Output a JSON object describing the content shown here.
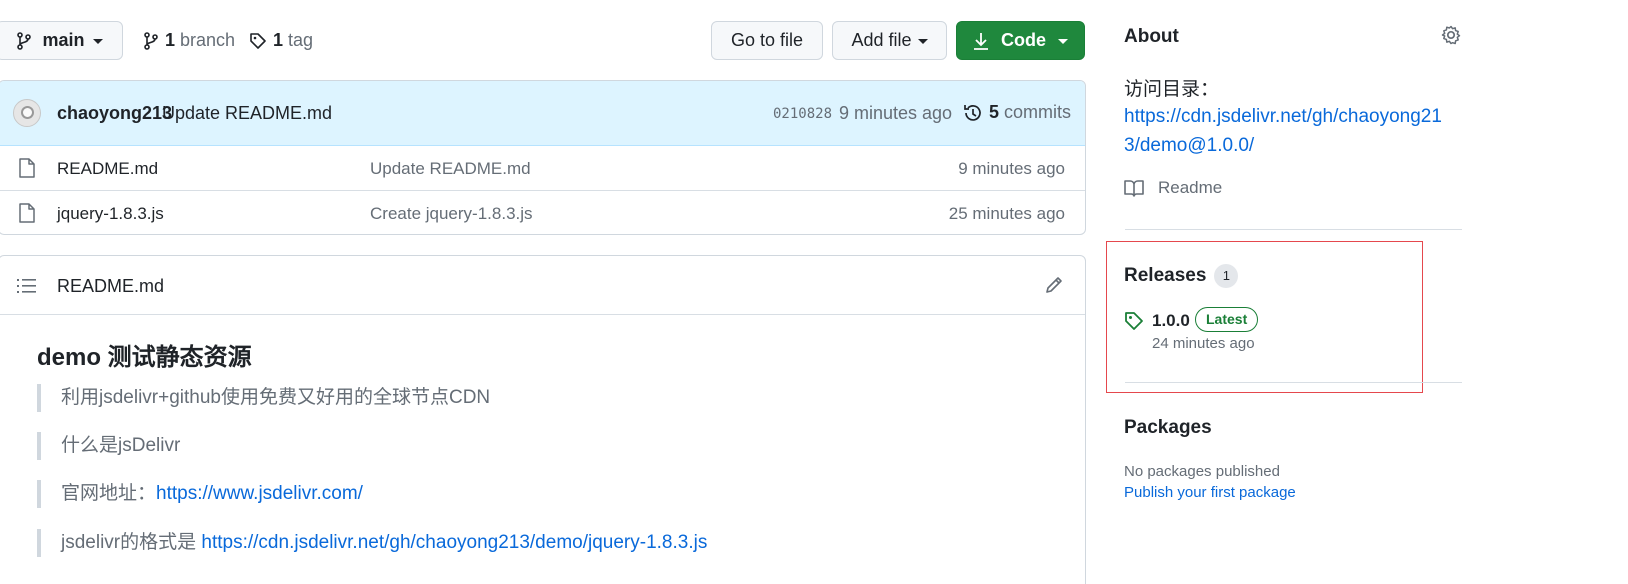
{
  "toolbar": {
    "branch_button": "main",
    "branches_count": "1",
    "branches_label": "branch",
    "tags_count": "1",
    "tags_label": "tag",
    "go_to_file": "Go to file",
    "add_file": "Add file",
    "code": "Code"
  },
  "commit": {
    "author": "chaoyong213",
    "message": "Update README.md",
    "sha": "0210828",
    "time": "9 minutes ago",
    "commits_count": "5",
    "commits_label": "commits"
  },
  "files": [
    {
      "name": "README.md",
      "message": "Update README.md",
      "age": "9 minutes ago"
    },
    {
      "name": "jquery-1.8.3.js",
      "message": "Create jquery-1.8.3.js",
      "age": "25 minutes ago"
    }
  ],
  "readme": {
    "filename": "README.md",
    "heading": "demo 测试静态资源",
    "quotes": [
      {
        "text": "利用jsdelivr+github使用免费又好用的全球节点CDN",
        "link": ""
      },
      {
        "text": "什么是jsDelivr",
        "link": ""
      },
      {
        "text": "官网地址：",
        "link": "https://www.jsdelivr.com/"
      },
      {
        "text": "jsdelivr的格式是 ",
        "link": "https://cdn.jsdelivr.net/gh/chaoyong213/demo/jquery-1.8.3.js"
      }
    ]
  },
  "about": {
    "title": "About",
    "label": "访问目录：",
    "link_line1": "https://cdn.jsdelivr.net/gh/chaoyong21",
    "link_line2": "3/demo@1.0.0/",
    "readme": "Readme"
  },
  "releases": {
    "title": "Releases",
    "count": "1",
    "version": "1.0.0",
    "badge": "Latest",
    "time": "24 minutes ago"
  },
  "packages": {
    "title": "Packages",
    "none": "No packages published",
    "publish_link": "Publish your first package"
  },
  "colors": {
    "accent": "#0969da",
    "green": "#1f883d",
    "highlight_box": "#e5484d"
  }
}
